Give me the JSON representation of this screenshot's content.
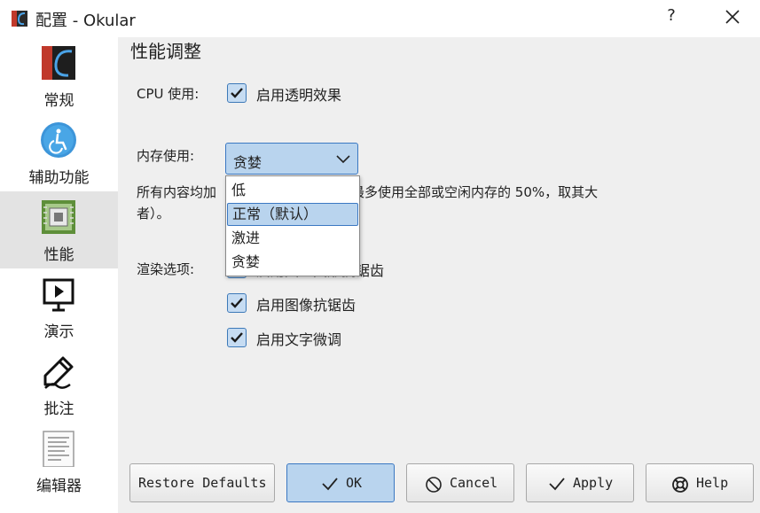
{
  "window": {
    "title": "配置 - Okular",
    "help_symbol": "?"
  },
  "sidebar": {
    "items": [
      {
        "label": "常规",
        "icon": "okular-logo-icon"
      },
      {
        "label": "辅助功能",
        "icon": "accessibility-icon"
      },
      {
        "label": "性能",
        "icon": "performance-chip-icon",
        "active": true
      },
      {
        "label": "演示",
        "icon": "presentation-icon"
      },
      {
        "label": "批注",
        "icon": "annotation-pen-icon"
      },
      {
        "label": "编辑器",
        "icon": "editor-document-icon"
      }
    ]
  },
  "main": {
    "section_title": "性能调整",
    "cpu": {
      "label": "CPU 使用:",
      "transparency": {
        "label": "启用透明效果",
        "checked": true
      }
    },
    "memory": {
      "label": "内存使用:",
      "selected": "贪婪",
      "options": [
        "低",
        "正常（默认）",
        "激进",
        "贪婪"
      ],
      "highlighted": "正常（默认）"
    },
    "description_line1_left": "所有内容均加",
    "description_line1_right": "所有页面（将最多使用全部或空闲内存的 50%，取其大",
    "description_line2": "者）。",
    "render": {
      "label": "渲染选项:",
      "option1": {
        "label": "启用矢量图形抗锯齿",
        "checked": true
      },
      "option2": {
        "label": "启用图像抗锯齿",
        "checked": true
      },
      "option3": {
        "label": "启用文字微调",
        "checked": true
      }
    }
  },
  "buttons": {
    "restore_defaults": "Restore Defaults",
    "ok": "OK",
    "cancel": "Cancel",
    "apply": "Apply",
    "help": "Help"
  },
  "colors": {
    "accent_fill": "#b9d4ee",
    "accent_border": "#3b78c2",
    "checkbox_fill": "#c6dcf2"
  }
}
